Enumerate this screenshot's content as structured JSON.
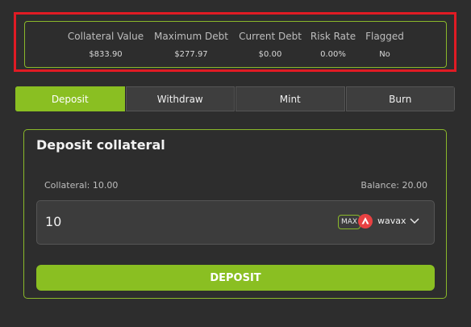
{
  "stats": [
    {
      "label": "Collateral Value",
      "value": "$833.90"
    },
    {
      "label": "Maximum Debt",
      "value": "$277.97"
    },
    {
      "label": "Current Debt",
      "value": "$0.00"
    },
    {
      "label": "Risk Rate",
      "value": "0.00%"
    },
    {
      "label": "Flagged",
      "value": "No"
    }
  ],
  "tabs": [
    "Deposit",
    "Withdraw",
    "Mint",
    "Burn"
  ],
  "active_tab": "Deposit",
  "card": {
    "title": "Deposit collateral",
    "collateral_label": "Collateral: 10.00",
    "balance_label": "Balance: 20.00",
    "input_value": "10",
    "max_label": "MAX",
    "token_name": "wavax",
    "token_icon": "avalanche-logo",
    "deposit_label": "DEPOSIT"
  },
  "colors": {
    "accent": "#8abf22",
    "highlight": "#e01b24",
    "background": "#2d2d2d",
    "token_icon": "#e84142"
  }
}
